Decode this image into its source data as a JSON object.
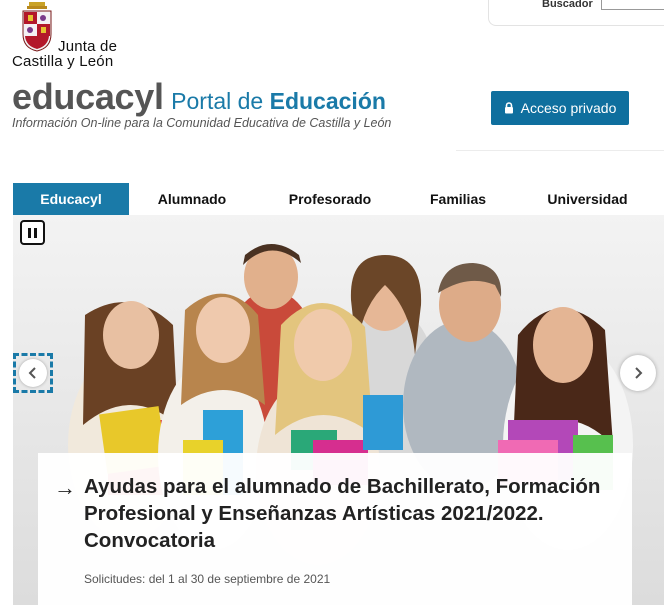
{
  "search": {
    "label": "Buscador",
    "value": ""
  },
  "logo": {
    "line1": "Junta de",
    "line2": "Castilla y León"
  },
  "brand": {
    "name": "educacyl",
    "portal_prefix": "Portal de ",
    "portal_strong": "Educación",
    "tagline": "Información On-line para la Comunidad Educativa de Castilla y León"
  },
  "private_access": {
    "label": "Acceso privado",
    "icon": "lock-icon"
  },
  "nav": {
    "items": [
      {
        "label": "Educacyl",
        "active": true
      },
      {
        "label": "Alumnado",
        "active": false
      },
      {
        "label": "Profesorado",
        "active": false
      },
      {
        "label": "Familias",
        "active": false
      },
      {
        "label": "Universidad",
        "active": false
      }
    ]
  },
  "slider": {
    "title": "Ayudas para el alumnado de Bachillerato, Formación Profesional y Enseñanzas Artísticas 2021/2022. Convocatoria",
    "subtitle": "Solicitudes: del 1 al 30 de septiembre de 2021",
    "arrow_glyph": "→"
  },
  "colors": {
    "accent": "#1a7aa8",
    "button": "#0f6f9e"
  }
}
